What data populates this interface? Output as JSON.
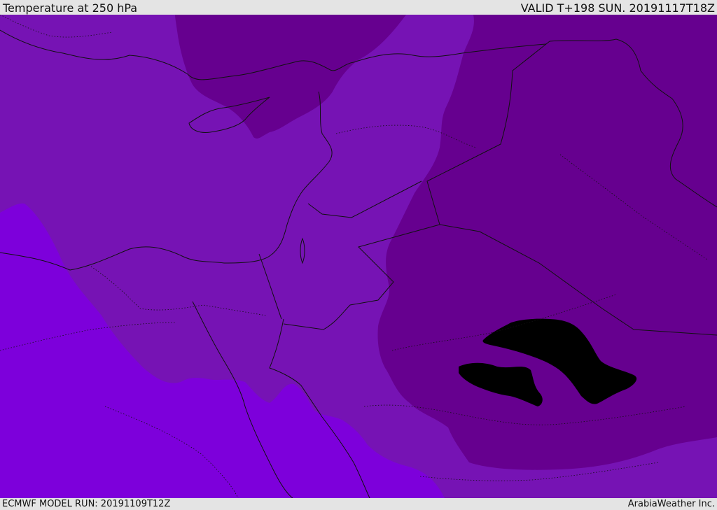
{
  "header": {
    "title": "Temperature at 250 hPa",
    "valid": "VALID T+198 SUN. 20191117T18Z"
  },
  "footer": {
    "model_run": "ECMWF MODEL RUN: 20191109T12Z",
    "credit": "ArabiaWeather Inc."
  },
  "map": {
    "field": "temperature-250hPa",
    "colors": {
      "warmest": "#7d00db",
      "mid": "#7613b4",
      "cool": "#66008f",
      "coolest": "#5a007e",
      "border": "#111111"
    }
  }
}
